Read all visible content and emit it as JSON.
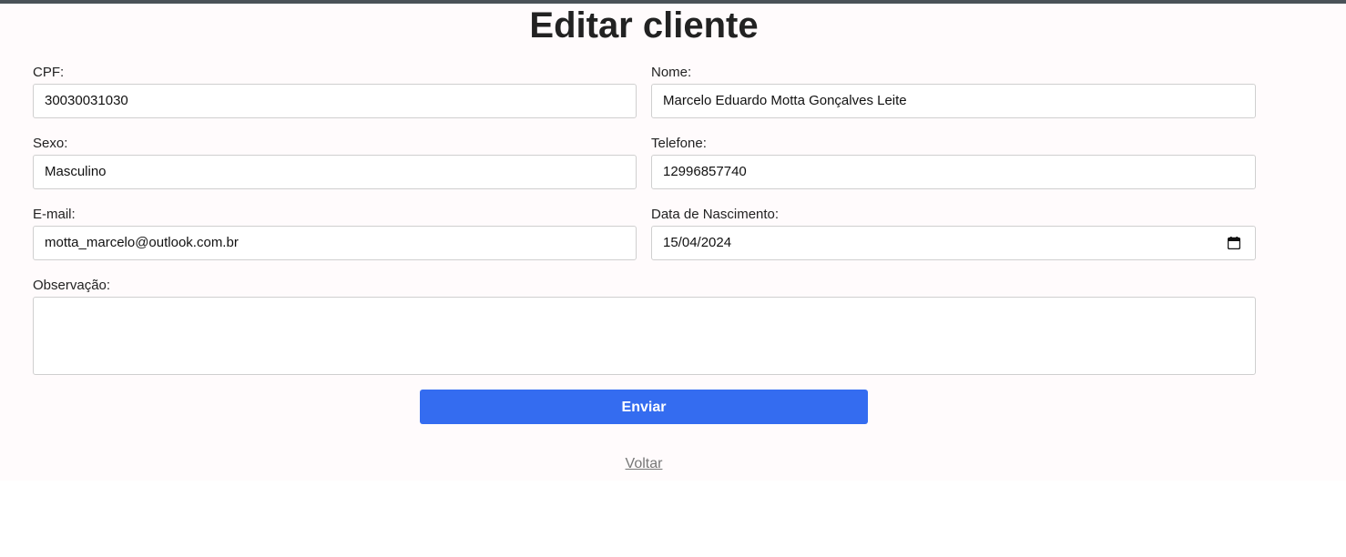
{
  "page": {
    "title": "Editar cliente"
  },
  "form": {
    "cpf": {
      "label": "CPF:",
      "value": "30030031030"
    },
    "nome": {
      "label": "Nome:",
      "value": "Marcelo Eduardo Motta Gonçalves Leite"
    },
    "sexo": {
      "label": "Sexo:",
      "value": "Masculino"
    },
    "telefone": {
      "label": "Telefone:",
      "value": "12996857740"
    },
    "email": {
      "label": "E-mail:",
      "value": "motta_marcelo@outlook.com.br"
    },
    "nascimento": {
      "label": "Data de Nascimento:",
      "value": "15/04/2024",
      "icon": "calendar-icon"
    },
    "observacao": {
      "label": "Observação:",
      "value": ""
    }
  },
  "actions": {
    "submit_label": "Enviar",
    "back_label": "Voltar"
  },
  "colors": {
    "accent": "#346cf0",
    "top_rule": "#4a5258",
    "background": "#fffbfc"
  }
}
